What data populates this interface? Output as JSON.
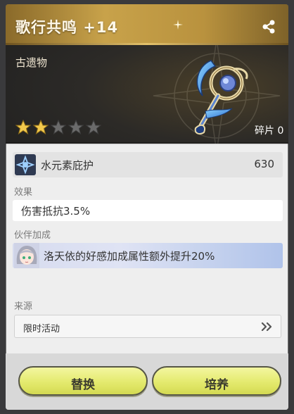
{
  "header": {
    "title": "歌行共鸣 +14",
    "type_label": "古遗物",
    "stars_filled": 2,
    "stars_total": 5,
    "fragments": "碎片 0"
  },
  "stat": {
    "name": "水元素庇护",
    "value": "630"
  },
  "effect": {
    "label": "效果",
    "text": "伤害抵抗3.5%"
  },
  "partner": {
    "label": "伙伴加成",
    "text": "洛天依的好感加成属性额外提升20%"
  },
  "source": {
    "label": "来源",
    "text": "限时活动"
  },
  "buttons": {
    "replace": "替换",
    "train": "培养"
  },
  "icons": [
    "share-icon",
    "sparkle-icon",
    "star-icon",
    "water-element-icon",
    "chevron-double-right-icon",
    "weapon-image",
    "partner-avatar"
  ],
  "colors": {
    "title_gold": "#c8a24a",
    "button_yellow": "#e4ea6e",
    "star_gold": "#f2c94c",
    "star_empty": "#6b6b6b"
  }
}
